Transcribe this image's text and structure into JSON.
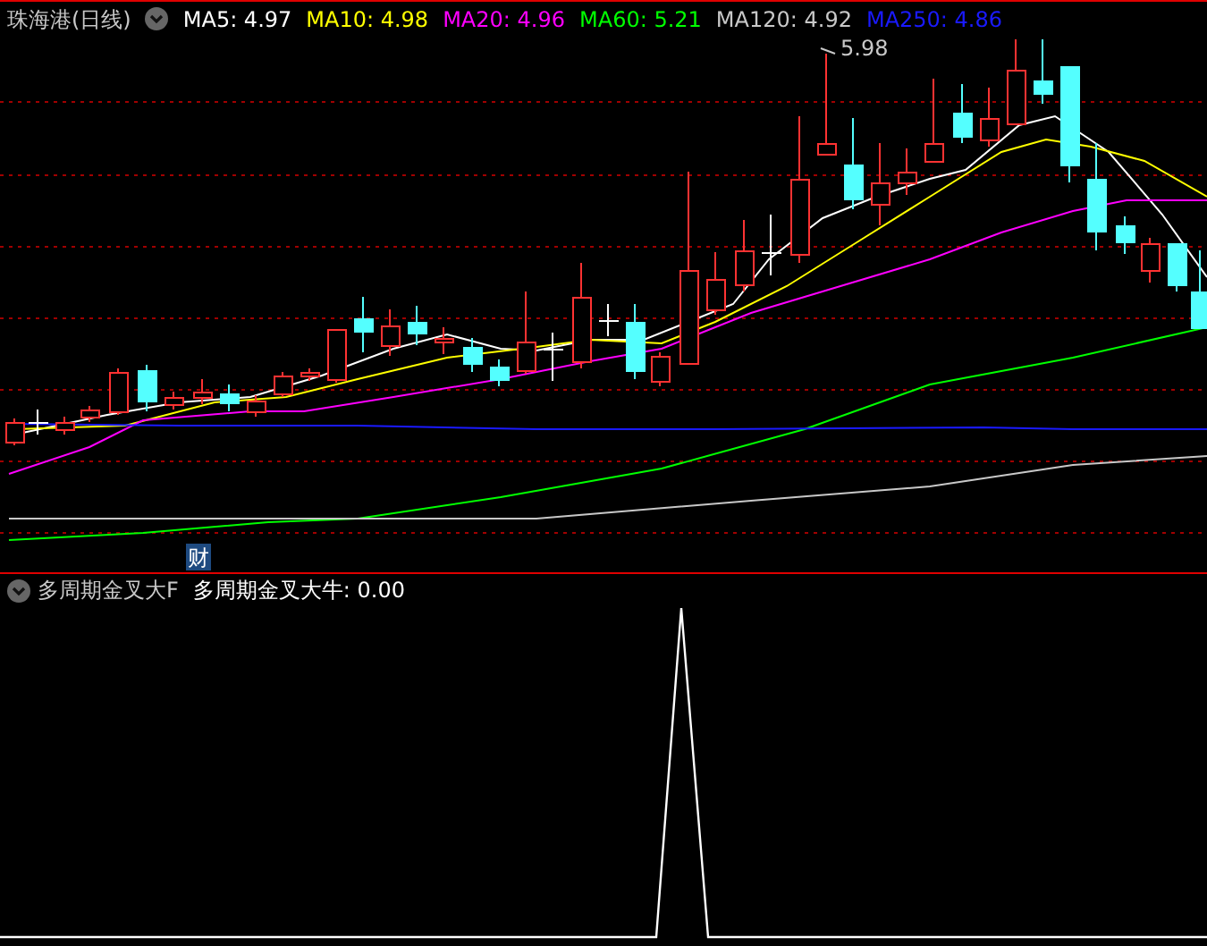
{
  "header": {
    "title": "珠海港(日线)"
  },
  "ma_legend": [
    {
      "text": "MA5: 4.97",
      "color": "#ffffff"
    },
    {
      "text": "MA10: 4.98",
      "color": "#ffff00"
    },
    {
      "text": "MA20: 4.96",
      "color": "#ff00ff"
    },
    {
      "text": "MA60: 5.21",
      "color": "#00ff00"
    },
    {
      "text": "MA120: 4.92",
      "color": "#c8c8c8"
    },
    {
      "text": "MA250: 4.86",
      "color": "#1a1aff"
    }
  ],
  "price_chart": {
    "high_label": "5.98",
    "event_marker": "财"
  },
  "indicator": {
    "title": "多周期金叉大F",
    "reading": "多周期金叉大牛: 0.00"
  }
}
